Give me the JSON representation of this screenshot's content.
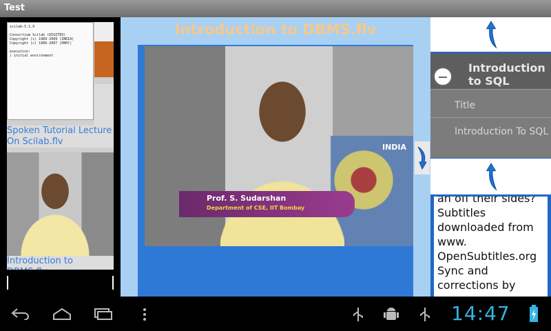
{
  "window": {
    "title": "Test"
  },
  "playlist": {
    "items": [
      {
        "label": "Spoken Tutorial Lecture On Scilab.flv",
        "screen_text": "scilab-5.1.9\n\nConsortium Scilab (DIGITEO)\nCopyright (c) 1989-2009 (INRIA)\nCopyright (c) 1989-2007 (ENPC)\n\nexecution:\n) initial environment"
      },
      {
        "label": "Introduction to DBMS.flv"
      }
    ]
  },
  "player": {
    "title": "Introduction to DBMS.flv",
    "lower_third_name": "Prof. S. Sudarshan",
    "lower_third_dept": "Department of CSE, IIT Bombay",
    "backdrop_text": "INDIA"
  },
  "details": {
    "section_title": "Introduction to SQL",
    "field_label": "Title",
    "field_value": "Introduction To SQL",
    "subtitles_text": "an off their sides? Subtitles downloaded from www. OpenSubtitles.org Sync and corrections by"
  },
  "statusbar": {
    "time": "14:47"
  },
  "colors": {
    "accent": "#33b5e5",
    "panel_blue": "#2f79d6",
    "title_orange": "#f6c88a"
  }
}
